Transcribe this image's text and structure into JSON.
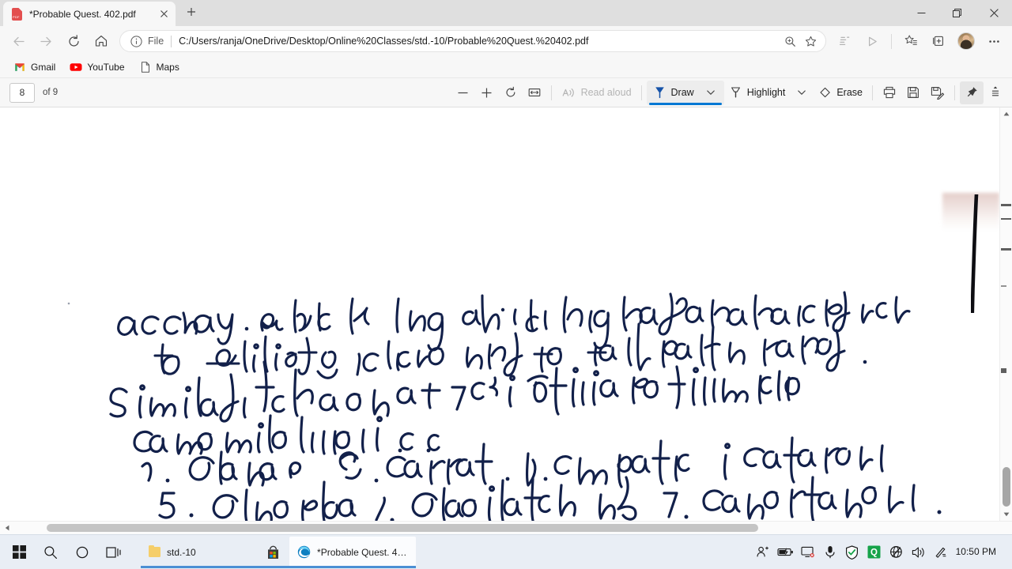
{
  "window": {
    "minimize_label": "Minimize",
    "restore_label": "Restore",
    "close_label": "Close"
  },
  "tab": {
    "title": "*Probable Quest. 402.pdf",
    "favicon": "pdf-file-icon",
    "favicon_text": "PDF",
    "close_icon": "close-icon",
    "new_tab_icon": "plus-icon"
  },
  "nav": {
    "back_icon": "back-arrow-icon",
    "forward_icon": "forward-arrow-icon",
    "refresh_icon": "refresh-icon",
    "home_icon": "home-icon",
    "info_icon": "info-circle-icon",
    "file_label": "File",
    "url": "C:/Users/ranja/OneDrive/Desktop/Online%20Classes/std.-10/Probable%20Quest.%20402.pdf",
    "zoom_icon": "zoom-search-icon",
    "favorite_icon": "star-icon",
    "immersive_reader_icon": "immersive-reader-icon",
    "read_aloud_icon": "play-icon",
    "favorites_icon": "favorites-star-icon",
    "collections_icon": "collections-icon",
    "profile_icon": "profile-avatar",
    "settings_icon": "ellipsis-icon"
  },
  "bookmarks": [
    {
      "label": "Gmail",
      "icon": "gmail-icon"
    },
    {
      "label": "YouTube",
      "icon": "youtube-icon"
    },
    {
      "label": "Maps",
      "icon": "page-icon"
    }
  ],
  "pdf_toolbar": {
    "page_number": "8",
    "page_total": "of 9",
    "zoom_out_icon": "minus-icon",
    "zoom_in_icon": "plus-icon",
    "rotate_icon": "rotate-icon",
    "fit_page_icon": "fit-to-page-icon",
    "read_aloud_icon": "read-aloud-icon",
    "read_aloud_label": "Read aloud",
    "draw_icon": "pen-icon",
    "draw_label": "Draw",
    "draw_dropdown_icon": "chevron-down-icon",
    "highlight_icon": "highlighter-icon",
    "highlight_label": "Highlight",
    "highlight_dropdown_icon": "chevron-down-icon",
    "erase_icon": "eraser-icon",
    "erase_label": "Erase",
    "print_icon": "print-icon",
    "save_icon": "save-icon",
    "save_as_icon": "save-as-icon",
    "pin_icon": "pin-icon",
    "more_icon": "more-tools-icon",
    "active_tool": "Draw"
  },
  "document": {
    "handwritten_lines": [
      "accuracy. While length of comonunication refers",
      "to simplicity, precise and to the point speaking.",
      "Similarly there are 7 c's for effective written",
      "comonunication i.e.",
      "1. Clear    2. Correct .3. complete  4. Concrete",
      "5. Concise.   6. consideration & 7. Courteous ,"
    ],
    "ink_color": "#12204a"
  },
  "scrollbar": {
    "vertical_up_icon": "caret-up-icon",
    "vertical_down_icon": "caret-down-icon",
    "horizontal_left_icon": "caret-left-icon",
    "horizontal_right_icon": "caret-right-icon"
  },
  "taskbar": {
    "start_icon": "windows-start-icon",
    "search_icon": "search-icon",
    "cortana_icon": "cortana-circle-icon",
    "taskview_icon": "task-view-icon",
    "apps": [
      {
        "label": "std.-10",
        "icon": "folder-icon",
        "active": false
      },
      {
        "label": "",
        "icon": "microsoft-store-icon",
        "active": false
      },
      {
        "label": "*Probable Quest. 402....",
        "icon": "edge-icon",
        "active": true
      }
    ],
    "tray": [
      "people-icon",
      "battery-charging-icon",
      "display-icon",
      "microphone-icon",
      "windows-security-icon",
      "quick-heal-icon",
      "network-offline-icon",
      "volume-icon",
      "pen-tray-icon"
    ],
    "clock": "10:50 PM"
  }
}
